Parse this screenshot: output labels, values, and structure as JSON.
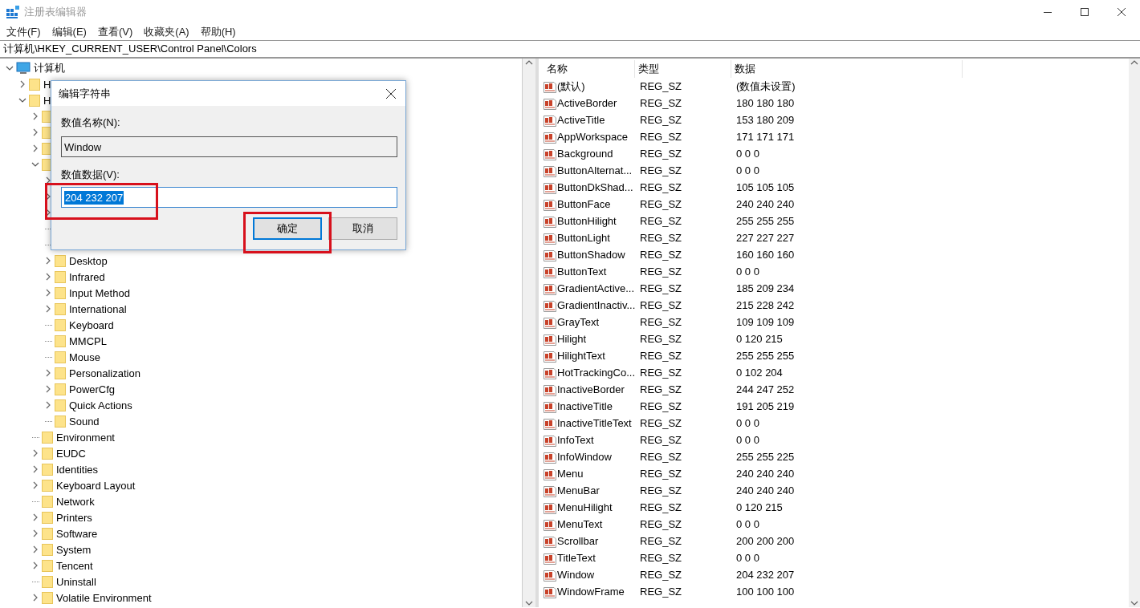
{
  "window": {
    "title": "注册表编辑器"
  },
  "menu": [
    "文件(F)",
    "编辑(E)",
    "查看(V)",
    "收藏夹(A)",
    "帮助(H)"
  ],
  "address": "计算机\\HKEY_CURRENT_USER\\Control Panel\\Colors",
  "tree": {
    "label": "计算机",
    "expandable": true,
    "expanded": true,
    "children": [
      {
        "label": "H",
        "expandable": true,
        "expanded": false
      },
      {
        "label": "H",
        "expandable": true,
        "expanded": true,
        "children": [
          {
            "expandable": true,
            "expanded": false
          },
          {
            "expandable": true,
            "expanded": false
          },
          {
            "expandable": true,
            "expanded": false
          },
          {
            "expandable": true,
            "expanded": true,
            "children": [
              {
                "expandable": true,
                "expanded": false
              },
              {
                "expandable": true,
                "expanded": false
              },
              {
                "expandable": true,
                "expanded": false
              },
              {
                "expandable": false
              },
              {
                "expandable": false
              },
              {
                "label": "Desktop",
                "expandable": true,
                "expanded": false
              },
              {
                "label": "Infrared",
                "expandable": true,
                "expanded": false
              },
              {
                "label": "Input Method",
                "expandable": true,
                "expanded": false
              },
              {
                "label": "International",
                "expandable": true,
                "expanded": false
              },
              {
                "label": "Keyboard",
                "expandable": false
              },
              {
                "label": "MMCPL",
                "expandable": false
              },
              {
                "label": "Mouse",
                "expandable": false
              },
              {
                "label": "Personalization",
                "expandable": true,
                "expanded": false
              },
              {
                "label": "PowerCfg",
                "expandable": true,
                "expanded": false
              },
              {
                "label": "Quick Actions",
                "expandable": true,
                "expanded": false
              },
              {
                "label": "Sound",
                "expandable": false
              }
            ]
          },
          {
            "label": "Environment",
            "expandable": false
          },
          {
            "label": "EUDC",
            "expandable": true,
            "expanded": false
          },
          {
            "label": "Identities",
            "expandable": true,
            "expanded": false
          },
          {
            "label": "Keyboard Layout",
            "expandable": true,
            "expanded": false
          },
          {
            "label": "Network",
            "expandable": false
          },
          {
            "label": "Printers",
            "expandable": true,
            "expanded": false
          },
          {
            "label": "Software",
            "expandable": true,
            "expanded": false
          },
          {
            "label": "System",
            "expandable": true,
            "expanded": false
          },
          {
            "label": "Tencent",
            "expandable": true,
            "expanded": false
          },
          {
            "label": "Uninstall",
            "expandable": false
          },
          {
            "label": "Volatile Environment",
            "expandable": true,
            "expanded": false
          }
        ]
      }
    ]
  },
  "list": {
    "columns": [
      "名称",
      "类型",
      "数据"
    ],
    "rows": [
      {
        "name": "(默认)",
        "type": "REG_SZ",
        "data": "(数值未设置)"
      },
      {
        "name": "ActiveBorder",
        "type": "REG_SZ",
        "data": "180 180 180"
      },
      {
        "name": "ActiveTitle",
        "type": "REG_SZ",
        "data": "153 180 209"
      },
      {
        "name": "AppWorkspace",
        "type": "REG_SZ",
        "data": "171 171 171"
      },
      {
        "name": "Background",
        "type": "REG_SZ",
        "data": "0 0 0"
      },
      {
        "name": "ButtonAlternat...",
        "type": "REG_SZ",
        "data": "0 0 0"
      },
      {
        "name": "ButtonDkShad...",
        "type": "REG_SZ",
        "data": "105 105 105"
      },
      {
        "name": "ButtonFace",
        "type": "REG_SZ",
        "data": "240 240 240"
      },
      {
        "name": "ButtonHilight",
        "type": "REG_SZ",
        "data": "255 255 255"
      },
      {
        "name": "ButtonLight",
        "type": "REG_SZ",
        "data": "227 227 227"
      },
      {
        "name": "ButtonShadow",
        "type": "REG_SZ",
        "data": "160 160 160"
      },
      {
        "name": "ButtonText",
        "type": "REG_SZ",
        "data": "0 0 0"
      },
      {
        "name": "GradientActive...",
        "type": "REG_SZ",
        "data": "185 209 234"
      },
      {
        "name": "GradientInactiv...",
        "type": "REG_SZ",
        "data": "215 228 242"
      },
      {
        "name": "GrayText",
        "type": "REG_SZ",
        "data": "109 109 109"
      },
      {
        "name": "Hilight",
        "type": "REG_SZ",
        "data": "0 120 215"
      },
      {
        "name": "HilightText",
        "type": "REG_SZ",
        "data": "255 255 255"
      },
      {
        "name": "HotTrackingCo...",
        "type": "REG_SZ",
        "data": "0 102 204"
      },
      {
        "name": "InactiveBorder",
        "type": "REG_SZ",
        "data": "244 247 252"
      },
      {
        "name": "InactiveTitle",
        "type": "REG_SZ",
        "data": "191 205 219"
      },
      {
        "name": "InactiveTitleText",
        "type": "REG_SZ",
        "data": "0 0 0"
      },
      {
        "name": "InfoText",
        "type": "REG_SZ",
        "data": "0 0 0"
      },
      {
        "name": "InfoWindow",
        "type": "REG_SZ",
        "data": "255 255 225"
      },
      {
        "name": "Menu",
        "type": "REG_SZ",
        "data": "240 240 240"
      },
      {
        "name": "MenuBar",
        "type": "REG_SZ",
        "data": "240 240 240"
      },
      {
        "name": "MenuHilight",
        "type": "REG_SZ",
        "data": "0 120 215"
      },
      {
        "name": "MenuText",
        "type": "REG_SZ",
        "data": "0 0 0"
      },
      {
        "name": "Scrollbar",
        "type": "REG_SZ",
        "data": "200 200 200"
      },
      {
        "name": "TitleText",
        "type": "REG_SZ",
        "data": "0 0 0"
      },
      {
        "name": "Window",
        "type": "REG_SZ",
        "data": "204 232 207"
      },
      {
        "name": "WindowFrame",
        "type": "REG_SZ",
        "data": "100 100 100"
      }
    ]
  },
  "dialog": {
    "title": "编辑字符串",
    "name_label": "数值名称(N):",
    "name_value": "Window",
    "data_label": "数值数据(V):",
    "data_value": "204 232 207",
    "data_highlighted": true,
    "buttons": [
      {
        "label": "确定",
        "default": true,
        "highlighted": true
      },
      {
        "label": "取消",
        "default": false,
        "highlighted": false
      }
    ]
  }
}
